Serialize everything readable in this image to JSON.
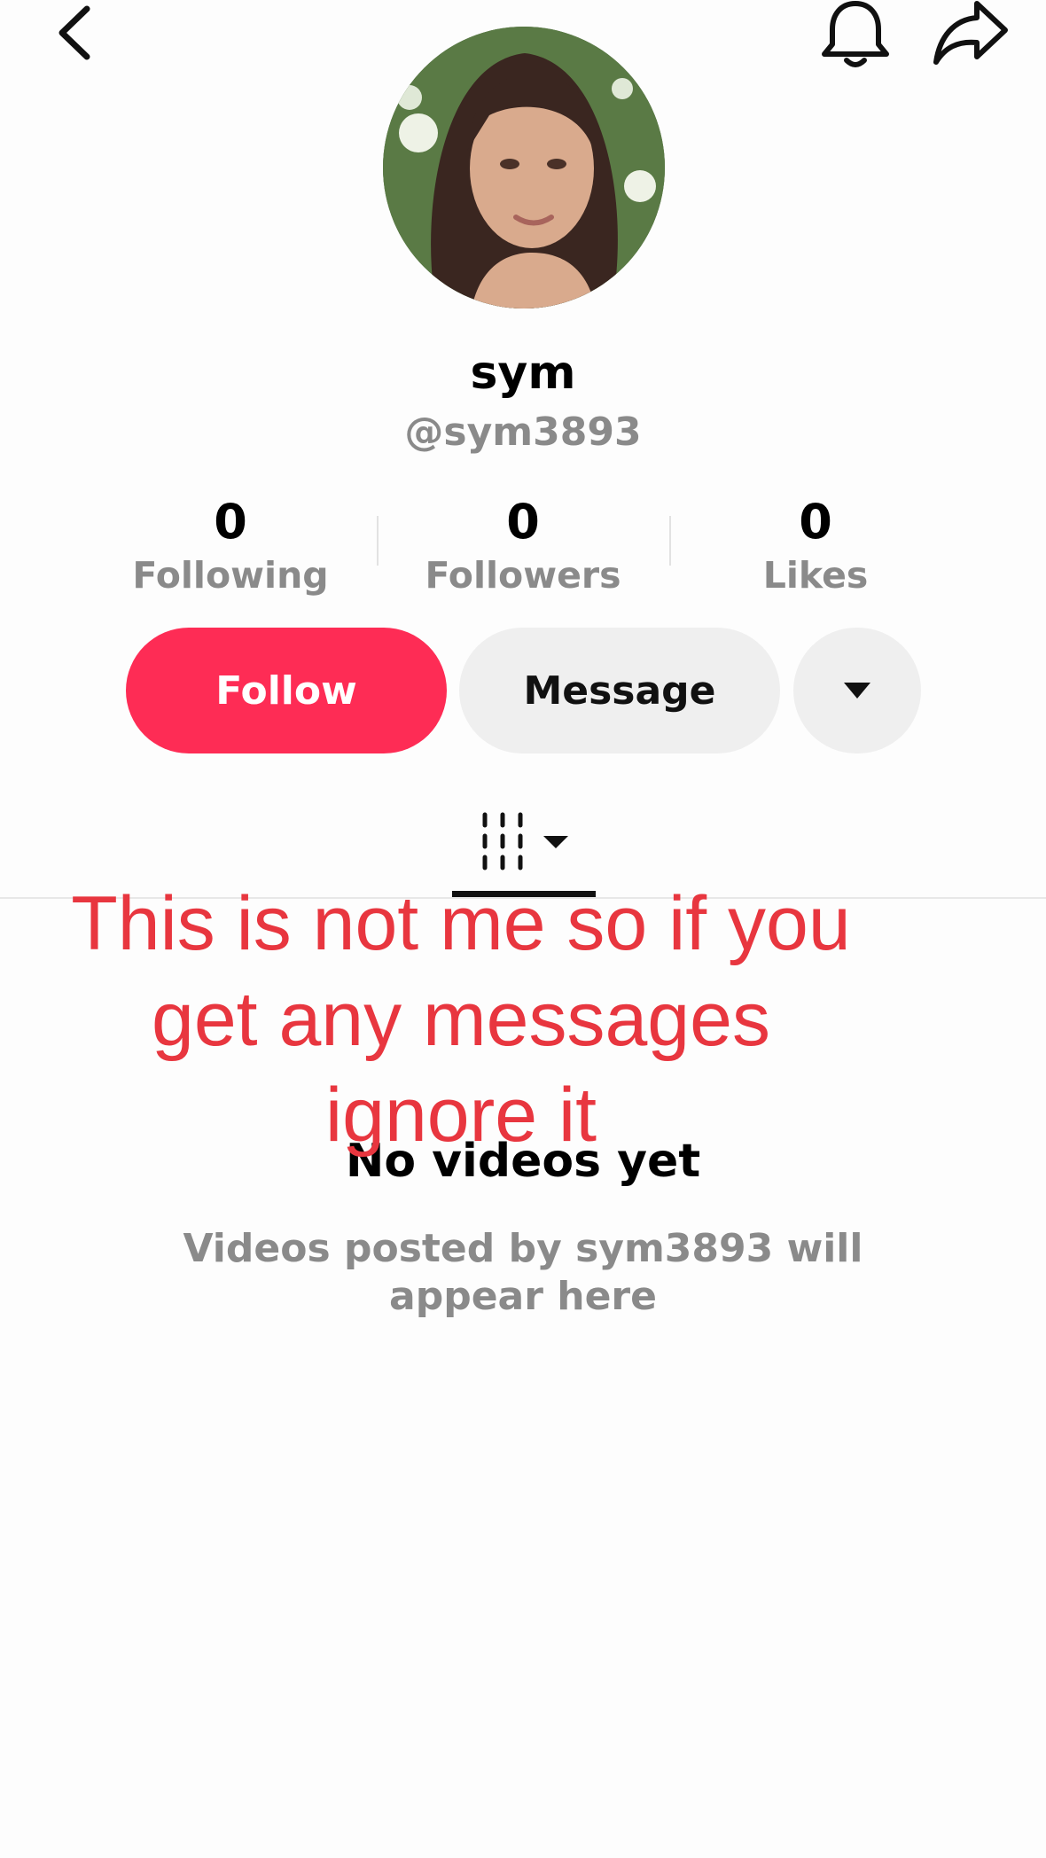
{
  "top_bar": {
    "back_icon": "chevron-left-icon",
    "notification_icon": "bell-icon",
    "share_icon": "share-arrow-icon"
  },
  "profile": {
    "display_name": "sym",
    "handle": "@sym3893"
  },
  "stats": {
    "following": {
      "value": "0",
      "label": "Following"
    },
    "followers": {
      "value": "0",
      "label": "Followers"
    },
    "likes": {
      "value": "0",
      "label": "Likes"
    }
  },
  "actions": {
    "follow_label": "Follow",
    "message_label": "Message",
    "more_icon": "caret-down-icon"
  },
  "tabs": {
    "videos_icon": "grid-icon"
  },
  "empty_state": {
    "title": "No videos yet",
    "description": "Videos posted by sym3893 will appear here"
  },
  "overlay": {
    "lines": [
      "This is not me so if you",
      "get any messages",
      "ignore it"
    ]
  },
  "colors": {
    "accent": "#fe2c55",
    "overlay_text": "#e8363f",
    "secondary_text": "#8a8a8a"
  }
}
